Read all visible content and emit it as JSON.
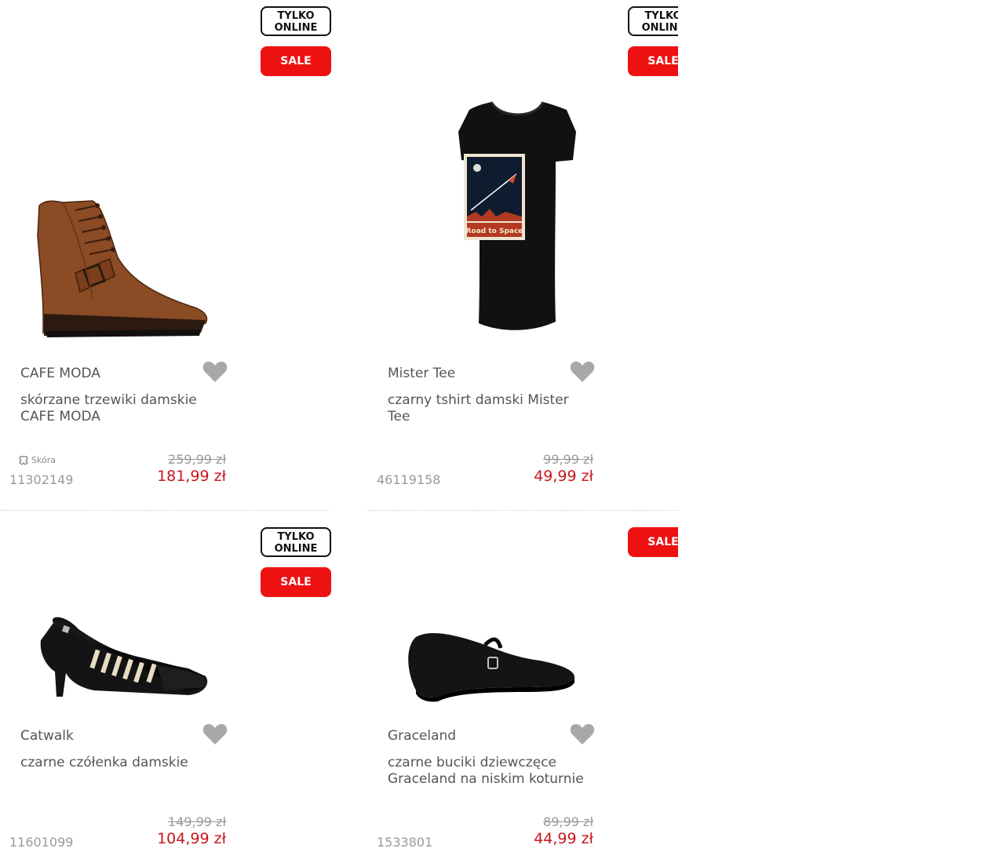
{
  "colors": {
    "sale_red": "#ee1111",
    "price_red": "#c8161d",
    "text_gray": "#555555",
    "muted_gray": "#999999",
    "heart_gray": "#a8a8a8"
  },
  "products": [
    {
      "badge_online_line1": "TYLKO",
      "badge_online_line2": "ONLINE",
      "badge_sale": "SALE",
      "image": "brown-leather-boot",
      "brand": "CAFE MODA",
      "title": "skórzane trzewiki damskie CAFE MODA",
      "material_icon": "leather-icon",
      "material": "Skóra",
      "sku": "11302149",
      "old_price": "259,99 zł",
      "new_price": "181,99 zł"
    },
    {
      "badge_online_line1": "TYLKO",
      "badge_online_line2": "ONLINE",
      "badge_sale": "SALE",
      "image": "black-tshirt-road-to-space",
      "print_text": "Road to Space",
      "brand": "Mister Tee",
      "title": "czarny tshirt damski Mister Tee",
      "sku": "46119158",
      "old_price": "99,99 zł",
      "new_price": "49,99 zł"
    },
    {
      "badge_online_line1": "TYLKO",
      "badge_online_line2": "ONLINE",
      "badge_sale": "SALE",
      "image": "black-slingback-pump",
      "brand": "Catwalk",
      "title": "czarne czółenka damskie",
      "sku": "11601099",
      "old_price": "149,99 zł",
      "new_price": "104,99 zł"
    },
    {
      "badge_sale": "SALE",
      "image": "black-wedge-mary-jane",
      "brand": "Graceland",
      "title": "czarne buciki dziewczęce Graceland na niskim koturnie",
      "sku": "1533801",
      "old_price": "89,99 zł",
      "new_price": "44,99 zł"
    }
  ]
}
